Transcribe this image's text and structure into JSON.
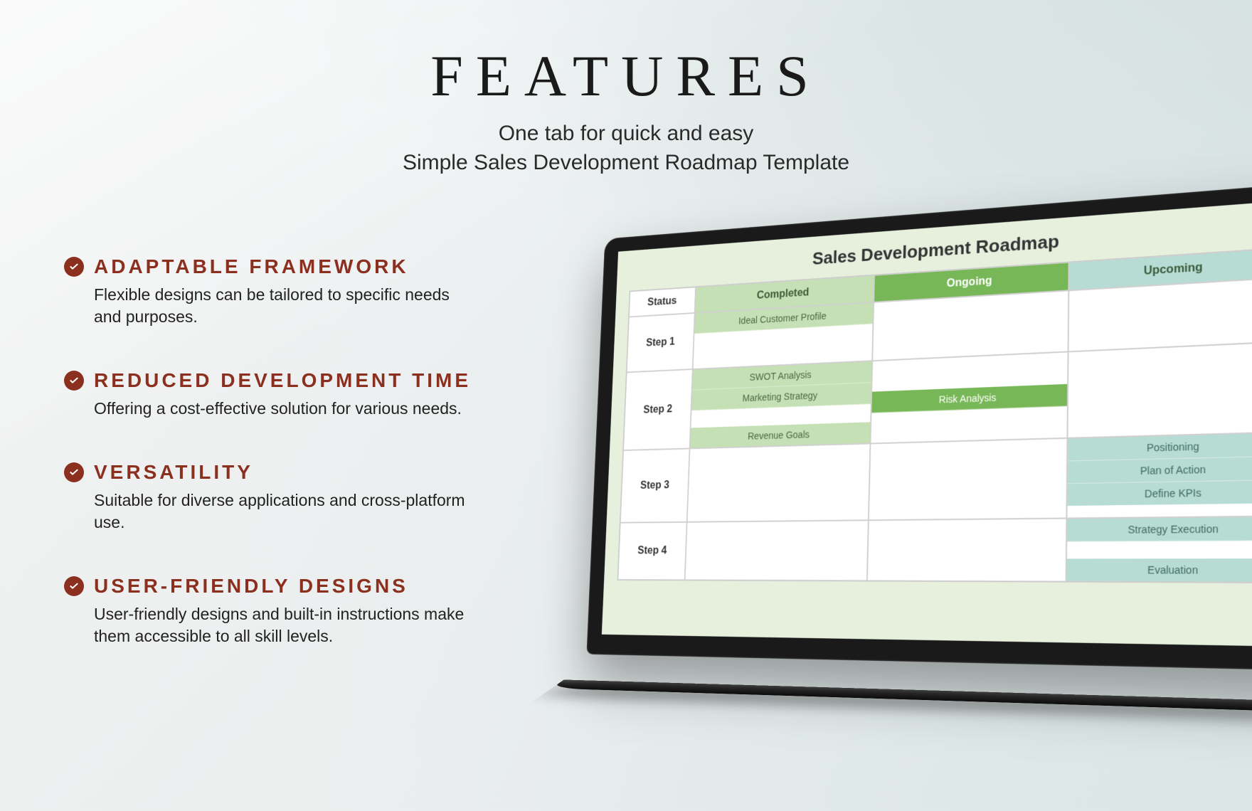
{
  "header": {
    "title": "FEATURES",
    "subtitle_line1": "One tab for quick and easy",
    "subtitle_line2": "Simple Sales Development Roadmap Template"
  },
  "features": [
    {
      "title": "ADAPTABLE FRAMEWORK",
      "desc": "Flexible designs can be tailored to specific needs and purposes."
    },
    {
      "title": "REDUCED DEVELOPMENT TIME",
      "desc": "Offering a cost-effective solution for various needs."
    },
    {
      "title": "VERSATILITY",
      "desc": "Suitable for diverse applications and cross-platform use."
    },
    {
      "title": "USER-FRIENDLY DESIGNS",
      "desc": "User-friendly designs and built-in instructions make them accessible to all skill levels."
    }
  ],
  "roadmap": {
    "title": "Sales Development Roadmap",
    "columns": {
      "status": "Status",
      "completed": "Completed",
      "ongoing": "Ongoing",
      "upcoming": "Upcoming"
    },
    "rows": [
      {
        "step": "Step 1",
        "completed": [
          "Ideal Customer Profile"
        ],
        "ongoing": [],
        "upcoming": []
      },
      {
        "step": "Step 2",
        "completed": [
          "SWOT Analysis",
          "Marketing Strategy",
          "Revenue Goals"
        ],
        "ongoing": [
          "Risk Analysis"
        ],
        "upcoming": []
      },
      {
        "step": "Step 3",
        "completed": [],
        "ongoing": [],
        "upcoming": [
          "Positioning",
          "Plan of Action",
          "Define KPIs"
        ]
      },
      {
        "step": "Step 4",
        "completed": [],
        "ongoing": [],
        "upcoming": [
          "Strategy Execution",
          "Evaluation"
        ]
      }
    ]
  },
  "colors": {
    "accent": "#8b2f1f",
    "completed": "#c5e0b4",
    "ongoing": "#78b757",
    "upcoming": "#b7dcd4"
  }
}
